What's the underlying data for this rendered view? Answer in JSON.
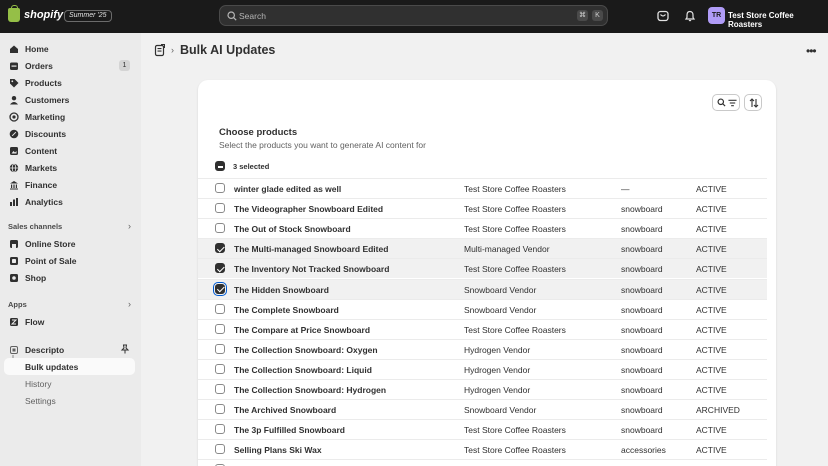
{
  "topbar": {
    "logo_text": "shopify",
    "edition": "Summer '25",
    "search_placeholder": "Search",
    "kbd1": "⌘",
    "kbd2": "K",
    "store_initials": "TR",
    "store_name": "Test Store Coffee Roasters"
  },
  "sidebar": {
    "items": [
      {
        "label": "Home",
        "icon": "home-icon"
      },
      {
        "label": "Orders",
        "icon": "orders-icon",
        "count": "1"
      },
      {
        "label": "Products",
        "icon": "tag-icon"
      },
      {
        "label": "Customers",
        "icon": "person-icon"
      },
      {
        "label": "Marketing",
        "icon": "target-icon"
      },
      {
        "label": "Discounts",
        "icon": "discount-icon"
      },
      {
        "label": "Content",
        "icon": "content-icon"
      },
      {
        "label": "Markets",
        "icon": "globe-icon"
      },
      {
        "label": "Finance",
        "icon": "bank-icon"
      },
      {
        "label": "Analytics",
        "icon": "chart-icon"
      }
    ],
    "sales_channels_label": "Sales channels",
    "channels": [
      {
        "label": "Online Store",
        "icon": "storefront-icon"
      },
      {
        "label": "Point of Sale",
        "icon": "pos-icon"
      },
      {
        "label": "Shop",
        "icon": "shop-icon"
      }
    ],
    "apps_label": "Apps",
    "apps": [
      {
        "label": "Flow",
        "icon": "flow-icon"
      },
      {
        "label": "Descripto",
        "icon": "descripto-icon"
      }
    ],
    "app_sub": [
      "Bulk updates",
      "History",
      "Settings"
    ]
  },
  "page": {
    "title": "Bulk AI Updates"
  },
  "card": {
    "title": "Choose products",
    "subtitle": "Select the products you want to generate AI content for",
    "selected_text": "3 selected"
  },
  "rows": [
    {
      "name": "winter glade edited as well",
      "vendor": "Test Store Coffee Roasters",
      "type": "—",
      "status": "ACTIVE",
      "checked": false
    },
    {
      "name": "The Videographer Snowboard Edited",
      "vendor": "Test Store Coffee Roasters",
      "type": "snowboard",
      "status": "ACTIVE",
      "checked": false
    },
    {
      "name": "The Out of Stock Snowboard",
      "vendor": "Test Store Coffee Roasters",
      "type": "snowboard",
      "status": "ACTIVE",
      "checked": false
    },
    {
      "name": "The Multi-managed Snowboard Edited",
      "vendor": "Multi-managed Vendor",
      "type": "snowboard",
      "status": "ACTIVE",
      "checked": true
    },
    {
      "name": "The Inventory Not Tracked Snowboard",
      "vendor": "Test Store Coffee Roasters",
      "type": "snowboard",
      "status": "ACTIVE",
      "checked": true
    },
    {
      "name": "The Hidden Snowboard",
      "vendor": "Snowboard Vendor",
      "type": "snowboard",
      "status": "ACTIVE",
      "checked": true
    },
    {
      "name": "The Complete Snowboard",
      "vendor": "Snowboard Vendor",
      "type": "snowboard",
      "status": "ACTIVE",
      "checked": false
    },
    {
      "name": "The Compare at Price Snowboard",
      "vendor": "Test Store Coffee Roasters",
      "type": "snowboard",
      "status": "ACTIVE",
      "checked": false
    },
    {
      "name": "The Collection Snowboard: Oxygen",
      "vendor": "Hydrogen Vendor",
      "type": "snowboard",
      "status": "ACTIVE",
      "checked": false
    },
    {
      "name": "The Collection Snowboard: Liquid",
      "vendor": "Hydrogen Vendor",
      "type": "snowboard",
      "status": "ACTIVE",
      "checked": false
    },
    {
      "name": "The Collection Snowboard: Hydrogen",
      "vendor": "Hydrogen Vendor",
      "type": "snowboard",
      "status": "ACTIVE",
      "checked": false
    },
    {
      "name": "The Archived Snowboard",
      "vendor": "Snowboard Vendor",
      "type": "snowboard",
      "status": "ARCHIVED",
      "checked": false
    },
    {
      "name": "The 3p Fulfilled Snowboard",
      "vendor": "Test Store Coffee Roasters",
      "type": "snowboard",
      "status": "ACTIVE",
      "checked": false
    },
    {
      "name": "Selling Plans Ski Wax",
      "vendor": "Test Store Coffee Roasters",
      "type": "accessories",
      "status": "ACTIVE",
      "checked": false
    },
    {
      "name": "",
      "vendor": "",
      "type": "",
      "status": "",
      "checked": false
    }
  ],
  "colors": {
    "topbar": "#1a1a1a",
    "sidebar": "#ebebeb",
    "avatar": "#b09cf7",
    "logo": "#95bf47"
  }
}
